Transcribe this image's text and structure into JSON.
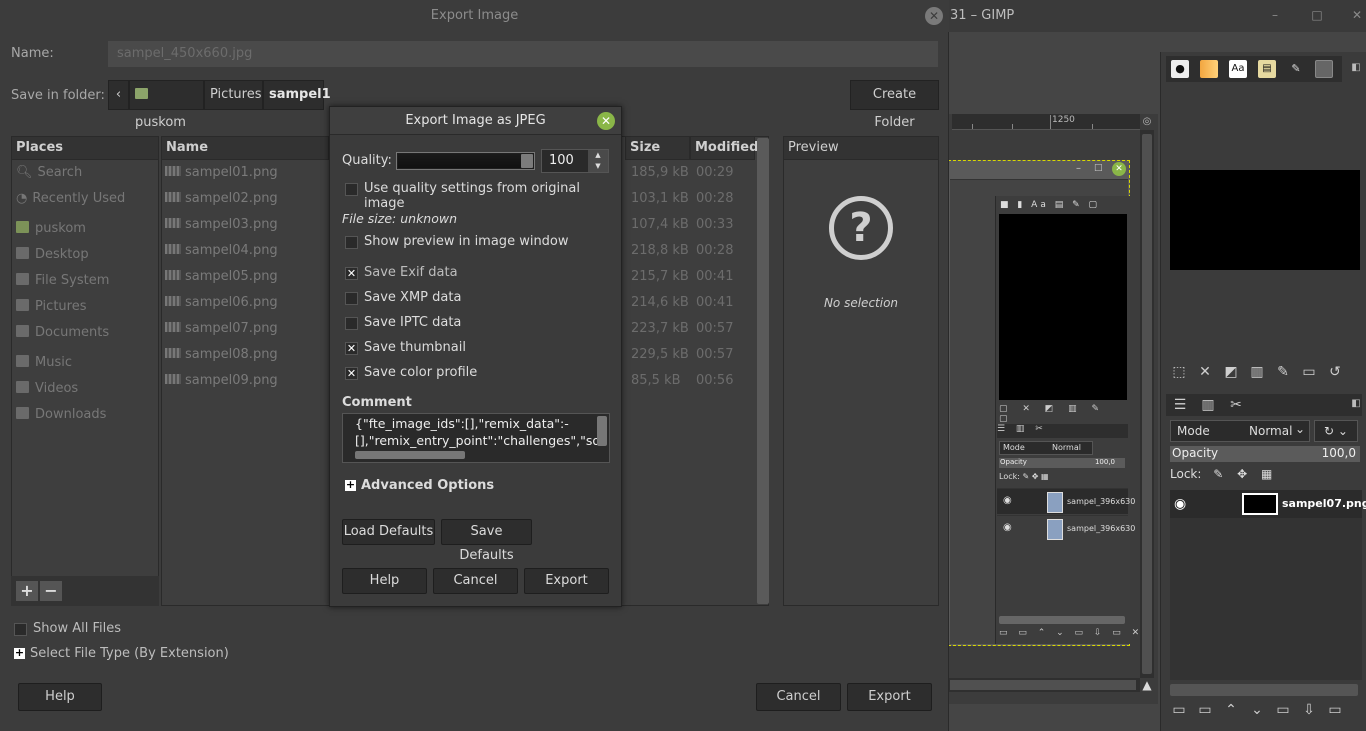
{
  "gimp": {
    "title": "31 – GIMP",
    "ruler_mark": "1250",
    "mini_mode": "Mode",
    "mini_mode_value": "Normal",
    "mini_opacity": "Opacity",
    "mini_opacity_value": "100,0",
    "mini_lock": "Lock:",
    "mini_layers": [
      "sampel_396x630",
      "sampel_396x630"
    ],
    "layers": {
      "mode_label": "Mode",
      "mode_value": "Normal",
      "opacity_label": "Opacity",
      "opacity_value": "100,0",
      "lock_label": "Lock:",
      "layer_name": "sampel07.png"
    }
  },
  "export": {
    "title": "Export Image",
    "name_label": "Name:",
    "name_value": "sampel_450x660.jpg",
    "save_in_label": "Save in folder:",
    "breadcrumbs": [
      "puskom",
      "Pictures",
      "sampel1"
    ],
    "create_folder": "Create Folder",
    "places_header": "Places",
    "places": [
      {
        "label": "Search",
        "icon": "search-icon"
      },
      {
        "label": "Recently Used",
        "icon": "clock-icon"
      },
      {
        "label": "puskom",
        "icon": "home-folder-icon"
      },
      {
        "label": "Desktop",
        "icon": "desktop-icon"
      },
      {
        "label": "File System",
        "icon": "drive-icon"
      },
      {
        "label": "Pictures",
        "icon": "folder-icon"
      },
      {
        "label": "Documents",
        "icon": "folder-icon"
      },
      {
        "label": "Music",
        "icon": "folder-icon"
      },
      {
        "label": "Videos",
        "icon": "folder-icon"
      },
      {
        "label": "Downloads",
        "icon": "folder-icon"
      }
    ],
    "columns": {
      "name": "Name",
      "size": "Size",
      "modified": "Modified"
    },
    "files": [
      {
        "name": "sampel01.png",
        "size": "185,9 kB",
        "modified": "00:29"
      },
      {
        "name": "sampel02.png",
        "size": "103,1 kB",
        "modified": "00:28"
      },
      {
        "name": "sampel03.png",
        "size": "107,4 kB",
        "modified": "00:33"
      },
      {
        "name": "sampel04.png",
        "size": "218,8 kB",
        "modified": "00:28"
      },
      {
        "name": "sampel05.png",
        "size": "215,7 kB",
        "modified": "00:41"
      },
      {
        "name": "sampel06.png",
        "size": "214,6 kB",
        "modified": "00:41"
      },
      {
        "name": "sampel07.png",
        "size": "223,7 kB",
        "modified": "00:57"
      },
      {
        "name": "sampel08.png",
        "size": "229,5 kB",
        "modified": "00:57"
      },
      {
        "name": "sampel09.png",
        "size": "85,5 kB",
        "modified": "00:56"
      }
    ],
    "preview_header": "Preview",
    "no_selection": "No selection",
    "show_all_files": "Show All Files",
    "select_file_type": "Select File Type (By Extension)",
    "help": "Help",
    "cancel": "Cancel",
    "export": "Export"
  },
  "jpeg": {
    "title": "Export Image as JPEG",
    "quality_label": "Quality:",
    "quality_value": "100",
    "quality_level": 1.0,
    "use_quality": "Use quality settings from original image",
    "file_size": "File size: unknown",
    "show_preview": "Show preview in image window",
    "save_exif": "Save Exif data",
    "save_xmp": "Save XMP data",
    "save_iptc": "Save IPTC data",
    "save_thumbnail": "Save thumbnail",
    "save_color_profile": "Save color profile",
    "comment_label": "Comment",
    "comment_line1": "{\"fte_image_ids\":[],\"remix_data\":-",
    "comment_line2": "[],\"remix_entry_point\":\"challenges\",\"so",
    "advanced": "Advanced Options",
    "load_defaults": "Load Defaults",
    "save_defaults": "Save Defaults",
    "help": "Help",
    "cancel": "Cancel",
    "export": "Export"
  },
  "colors": {
    "accent_green": "#8ab648",
    "selection_yellow": "#d9d900"
  }
}
